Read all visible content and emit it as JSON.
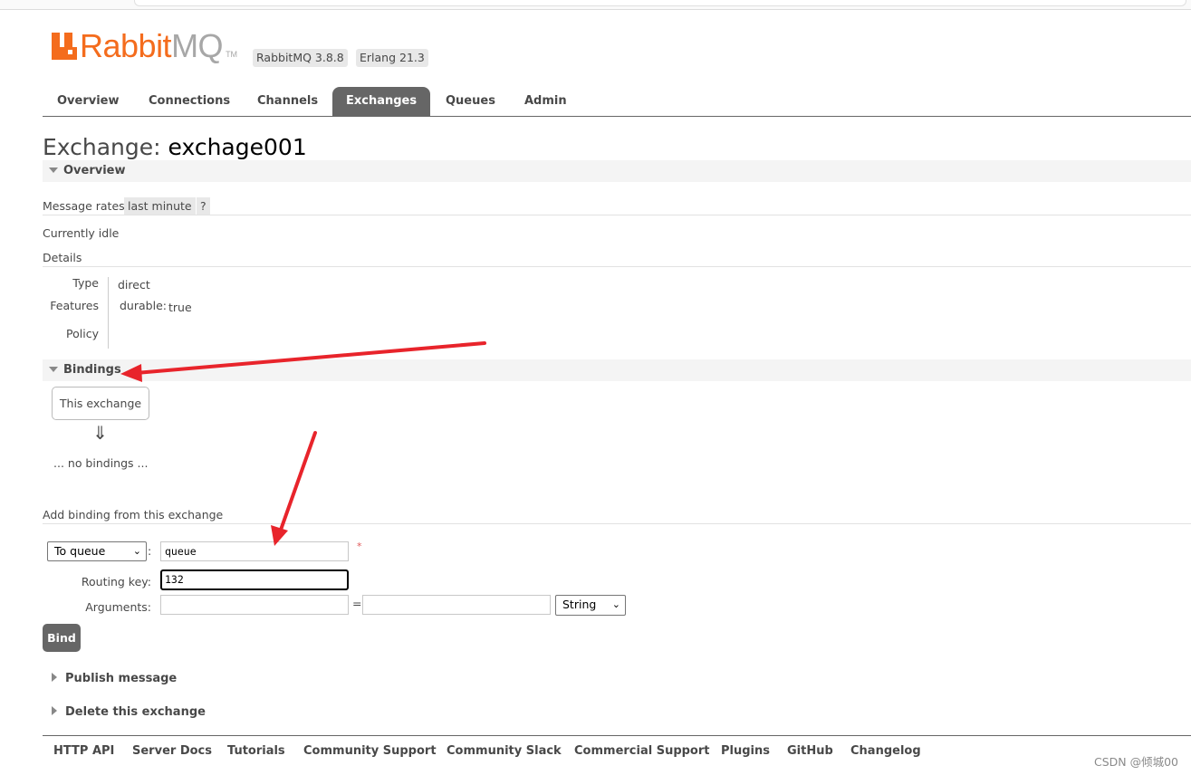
{
  "app": {
    "logo_rabbit": "Rabbit",
    "logo_mq": "MQ",
    "logo_tm": "TM",
    "rabbitmq_version": "RabbitMQ 3.8.8",
    "erlang_version": "Erlang 21.3",
    "brand_color": "#f46c1d"
  },
  "nav": {
    "tabs": [
      "Overview",
      "Connections",
      "Channels",
      "Exchanges",
      "Queues",
      "Admin"
    ],
    "active": "Exchanges"
  },
  "page": {
    "title_prefix": "Exchange:",
    "title_name": "exchage001"
  },
  "overview": {
    "section_label": "Overview",
    "message_rates_label": "Message rates",
    "rates_range": "last minute",
    "help": "?",
    "status": "Currently idle",
    "details_label": "Details",
    "type_key": "Type",
    "type_val": "direct",
    "features_key": "Features",
    "features_durable_key": "durable:",
    "features_durable_val": "true",
    "policy_key": "Policy"
  },
  "bindings": {
    "section_label": "Bindings",
    "this_exchange": "This exchange",
    "arrow": "⇓",
    "empty": "... no bindings ..."
  },
  "add_binding": {
    "heading": "Add binding from this exchange",
    "destination_type": "To queue",
    "colon": ":",
    "destination_value": "queue",
    "required_mark": "*",
    "routing_key_label": "Routing key:",
    "routing_key_value": "132",
    "arguments_label": "Arguments:",
    "arg_key": "",
    "equals": "=",
    "arg_value": "",
    "arg_type": "String",
    "bind_button": "Bind"
  },
  "collapsed_sections": {
    "publish": "Publish message",
    "delete": "Delete this exchange"
  },
  "footer": {
    "links": [
      "HTTP API",
      "Server Docs",
      "Tutorials",
      "Community Support",
      "Community Slack",
      "Commercial Support",
      "Plugins",
      "GitHub",
      "Changelog"
    ]
  },
  "watermark": "CSDN @倾城00",
  "annotation_color": "#e8242b"
}
